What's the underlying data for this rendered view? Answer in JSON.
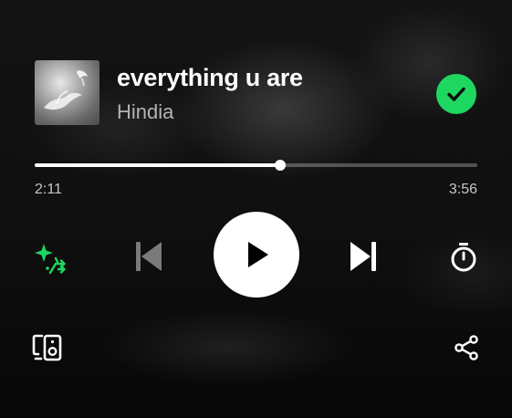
{
  "track": {
    "title": "everything u are",
    "artist": "Hindia",
    "saved": true
  },
  "progress": {
    "elapsed": "2:11",
    "total": "3:56",
    "fraction": 0.5551
  },
  "controls": {
    "icons": {
      "smart_shuffle": "smart-shuffle-icon",
      "previous": "skip-previous-icon",
      "play": "play-icon",
      "next": "skip-next-icon",
      "timer": "sleep-timer-icon",
      "devices": "connect-device-icon",
      "share": "share-icon"
    }
  },
  "colors": {
    "accent": "#1ed760",
    "background": "#0b0b0b",
    "secondary_text": "#b3b3b3"
  }
}
